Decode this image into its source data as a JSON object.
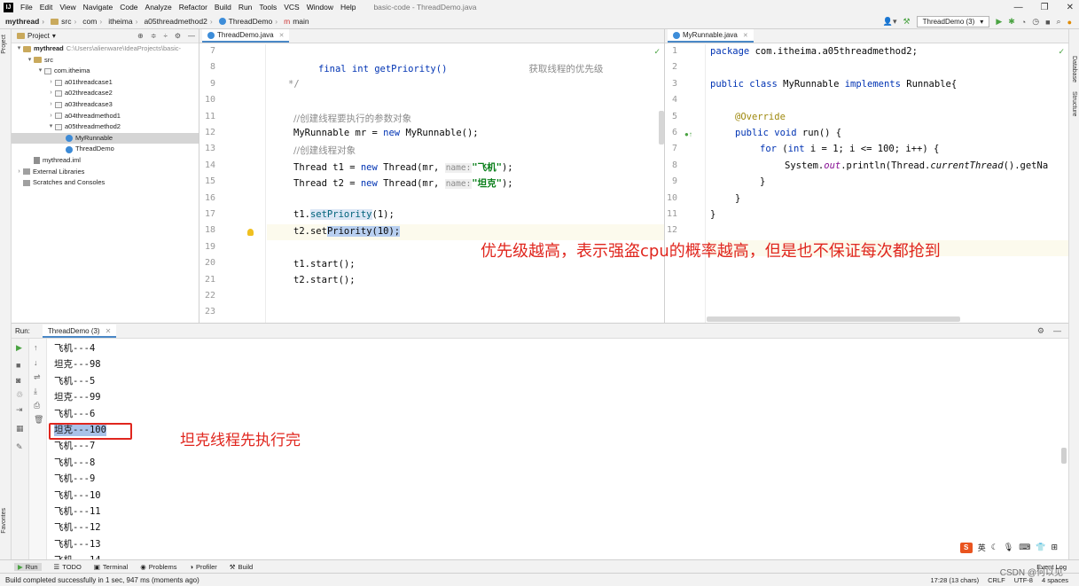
{
  "menubar": {
    "items": [
      "File",
      "Edit",
      "View",
      "Navigate",
      "Code",
      "Analyze",
      "Refactor",
      "Build",
      "Run",
      "Tools",
      "VCS",
      "Window",
      "Help"
    ],
    "window_title": "basic-code - ThreadDemo.java",
    "logo_text": "IJ"
  },
  "navbar": {
    "crumbs": [
      "mythread",
      "src",
      "com",
      "itheima",
      "a05threadmethod2",
      "ThreadDemo",
      "main"
    ],
    "run_config": "ThreadDemo (3)"
  },
  "left_strip": {
    "project_tab": "Project",
    "favorites_tab": "Favorites"
  },
  "right_strip": {
    "database_tab": "Database",
    "structure_tab": "Structure"
  },
  "project": {
    "title": "Project",
    "tree": [
      {
        "label": "mythread",
        "path": "C:\\Users\\alienware\\IdeaProjects\\basic-",
        "type": "module",
        "indent": 0,
        "arrow": "▾"
      },
      {
        "label": "src",
        "type": "folder",
        "indent": 1,
        "arrow": "▾"
      },
      {
        "label": "com.itheima",
        "type": "package",
        "indent": 2,
        "arrow": "▾"
      },
      {
        "label": "a01threadcase1",
        "type": "package",
        "indent": 3,
        "arrow": "›"
      },
      {
        "label": "a02threadcase2",
        "type": "package",
        "indent": 3,
        "arrow": "›"
      },
      {
        "label": "a03threadcase3",
        "type": "package",
        "indent": 3,
        "arrow": "›"
      },
      {
        "label": "a04threadmethod1",
        "type": "package",
        "indent": 3,
        "arrow": "›"
      },
      {
        "label": "a05threadmethod2",
        "type": "package",
        "indent": 3,
        "arrow": "▾"
      },
      {
        "label": "MyRunnable",
        "type": "class",
        "indent": 4,
        "arrow": "",
        "selected": true
      },
      {
        "label": "ThreadDemo",
        "type": "class",
        "indent": 4,
        "arrow": ""
      },
      {
        "label": "mythread.iml",
        "type": "iml",
        "indent": 1,
        "arrow": ""
      },
      {
        "label": "External Libraries",
        "type": "lib",
        "indent": 0,
        "arrow": "›"
      },
      {
        "label": "Scratches and Consoles",
        "type": "lib",
        "indent": 0,
        "arrow": ""
      }
    ]
  },
  "editor_left": {
    "tab": "ThreadDemo.java",
    "line_numbers": [
      "7",
      "8",
      "9",
      "10",
      "11",
      "12",
      "13",
      "14",
      "15",
      "16",
      "17",
      "18",
      "19",
      "20",
      "21",
      "22",
      "23"
    ],
    "doc_line_code": "final int getPriority()",
    "doc_line_desc": "获取线程的优先级",
    "comment_end": "*/",
    "comment1": "//创建线程要执行的参数对象",
    "line11": {
      "a": "MyRunnable mr = ",
      "kw": "new",
      "b": " MyRunnable();"
    },
    "comment2": "//创建线程对象",
    "line13": {
      "a": "Thread t1 = ",
      "kw": "new",
      "b": " Thread(mr, ",
      "hint": "name:",
      "str": "\"飞机\"",
      "c": ");"
    },
    "line14": {
      "a": "Thread t2 = ",
      "kw": "new",
      "b": " Thread(mr, ",
      "hint": "name:",
      "str": "\"坦克\"",
      "c": ");"
    },
    "line16": {
      "a": "t1.",
      "m": "setPriority",
      "b": "(1);"
    },
    "line17": {
      "a": "t2.set",
      "sel": "Priority(10);"
    },
    "line19": "t1.start();",
    "line20": "t2.start();"
  },
  "editor_right": {
    "tab": "MyRunnable.java",
    "line_numbers": [
      "1",
      "2",
      "3",
      "4",
      "5",
      "6",
      "7",
      "8",
      "9",
      "10",
      "11",
      "12"
    ],
    "line1": {
      "kw": "package",
      "b": " com.itheima.a05threadmethod2;"
    },
    "line3": {
      "kw1": "public class",
      "b": " MyRunnable ",
      "kw2": "implements",
      "c": " Runnable{"
    },
    "line5": "@Override",
    "line6": {
      "kw": "public void",
      "b": " run() {"
    },
    "line7": {
      "kw": "for",
      "b": " (",
      "kw2": "int",
      "c": " i = 1; i <= 100; i++) {"
    },
    "line8": {
      "a": "System.",
      "f": "out",
      "b": ".println(Thread.",
      "m": "currentThread",
      "c": "().getNa"
    },
    "line9": "}",
    "line10": "}",
    "line11": "}"
  },
  "annotations": {
    "priority_note": "优先级越高，表示强盗cpu的概率越高，但是也不保证每次都抢到",
    "finish_note": "坦克线程先执行完"
  },
  "run_panel": {
    "label": "Run:",
    "tab": "ThreadDemo (3)",
    "output": [
      "飞机---4",
      "坦克---98",
      "飞机---5",
      "坦克---99",
      "飞机---6",
      "坦克---100",
      "飞机---7",
      "飞机---8",
      "飞机---9",
      "飞机---10",
      "飞机---11",
      "飞机---12",
      "飞机---13",
      "飞机---14"
    ],
    "selected_index": 5,
    "tray_text": "英"
  },
  "bottom_tabs": [
    "Run",
    "TODO",
    "Terminal",
    "Problems",
    "Profiler",
    "Build"
  ],
  "event_log": "Event Log",
  "status": {
    "message": "Build completed successfully in 1 sec, 947 ms (moments ago)",
    "position": "17:28 (13 chars)",
    "line_sep": "CRLF",
    "encoding": "UTF-8",
    "indent": "4 spaces",
    "watermark": "CSDN @何以见"
  },
  "colors": {
    "accent": "#4a88c7",
    "annotation": "#e0261e",
    "keyword": "#0033b3",
    "string": "#067d17"
  }
}
